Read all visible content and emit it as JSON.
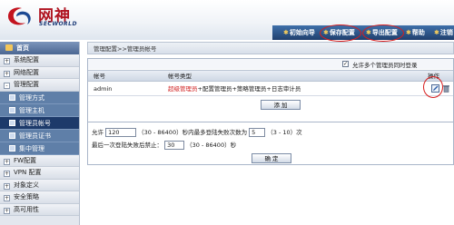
{
  "brand": {
    "name": "网神",
    "sub": "SECWORLD"
  },
  "header_nav": [
    {
      "label": "初始向导"
    },
    {
      "label": "保存配置"
    },
    {
      "label": "导出配置"
    },
    {
      "label": "帮助"
    },
    {
      "label": "注销"
    }
  ],
  "sidebar": {
    "home": "首页",
    "groups_top": [
      {
        "label": "系统配置",
        "toggle": "+"
      },
      {
        "label": "网络配置",
        "toggle": "+"
      },
      {
        "label": "管理配置",
        "toggle": "-"
      }
    ],
    "sub_items": [
      {
        "label": "管理方式"
      },
      {
        "label": "管理主机"
      },
      {
        "label": "管理员帐号"
      },
      {
        "label": "管理员证书"
      },
      {
        "label": "集中管理"
      }
    ],
    "groups_bottom": [
      {
        "label": "FW配置",
        "toggle": "+"
      },
      {
        "label": "VPN 配置",
        "toggle": "+"
      },
      {
        "label": "对象定义",
        "toggle": "+"
      },
      {
        "label": "安全策略",
        "toggle": "+"
      },
      {
        "label": "高可用性",
        "toggle": "+"
      }
    ]
  },
  "main": {
    "breadcrumb": "管理配置>>管理员帐号",
    "allow_multi_label": "允许多个管理员同时登录",
    "allow_multi_checked": "✓",
    "columns": {
      "account": "帐号",
      "type": "帐号类型",
      "action": "操作"
    },
    "rows": [
      {
        "account": "admin",
        "role_super": "超级管理员",
        "role_rest": "+配置管理员+策略管理员+日志审计员"
      }
    ],
    "add_label": "添 加",
    "login_rule": {
      "prefix": "允许",
      "seconds": "120",
      "range1": "（30 - 86400）秒内最多登陆失败次数为",
      "attempts": "5",
      "range2": "（3 - 10）次"
    },
    "lock_rule": {
      "prefix": "最后一次登陆失败后禁止：",
      "seconds": "30",
      "range": "（30 - 86400）秒"
    },
    "confirm_label": "确 定"
  },
  "colors": {
    "accent": "#1d3a6a",
    "brand_red": "#b01420",
    "highlight_ring": "#d81d1d"
  }
}
